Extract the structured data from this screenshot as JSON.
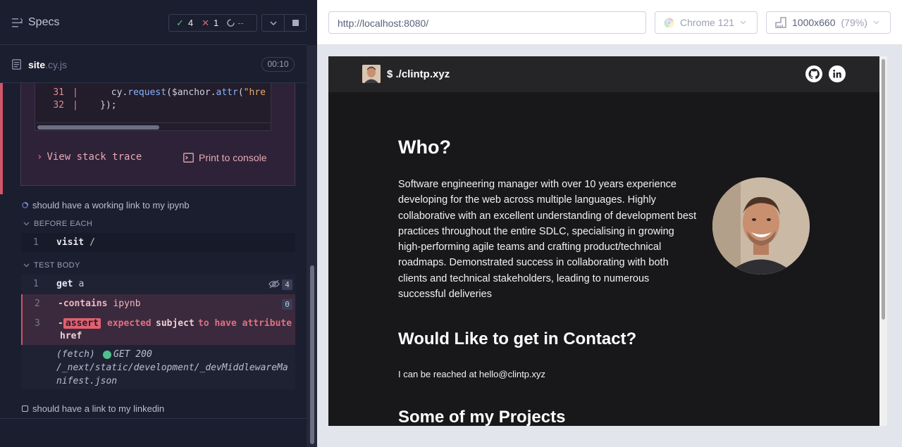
{
  "reporter": {
    "title": "Specs",
    "stats": {
      "passed": "4",
      "failed": "1",
      "pending": "--"
    },
    "file": {
      "name": "site",
      "ext": ".cy.js",
      "duration": "00:10"
    },
    "code_lines": [
      {
        "num": "31",
        "code": "      cy.request($anchor.attr(\"hre"
      },
      {
        "num": "32",
        "code": "    });"
      }
    ],
    "view_stack_trace": "View stack trace",
    "print_to_console": "Print to console",
    "tests": [
      {
        "title": "should have a working link to my ipynb"
      },
      {
        "title": "should have a link to my linkedin"
      }
    ],
    "before_each": {
      "label": "BEFORE EACH",
      "commands": [
        {
          "num": "1",
          "name": "visit",
          "arg": "/"
        }
      ]
    },
    "test_body": {
      "label": "TEST BODY",
      "commands": [
        {
          "num": "1",
          "name": "get",
          "arg": "a",
          "count": "4"
        },
        {
          "num": "2",
          "name": "-contains",
          "arg": "ipynb",
          "count": "0"
        },
        {
          "num": "3",
          "name": "-assert",
          "expected": "expected",
          "subject": "subject",
          "message": "to have attribute",
          "attr": "href"
        }
      ],
      "fetch": {
        "label": "(fetch)",
        "method": "GET 200",
        "url": "/_next/static/development/_devMiddlewareManifest.json"
      }
    }
  },
  "browser": {
    "url": "http://localhost:8080/",
    "name": "Chrome 121",
    "viewport": "1000x660",
    "zoom": "(79%)"
  },
  "site": {
    "logo": "$ ./clintp.xyz",
    "who_heading": "Who?",
    "bio": "Software engineering manager with over 10 years experience developing for the web across multiple languages. Highly collaborative with an excellent understanding of development best practices throughout the entire SDLC, specialising in growing high-performing agile teams and crafting product/technical roadmaps. Demonstrated success in collaborating with both clients and technical stakeholders, leading to numerous successful deliveries",
    "contact_heading": "Would Like to get in Contact?",
    "contact_text": "I can be reached at hello@clintp.xyz",
    "projects_heading": "Some of my Projects"
  },
  "colors": {
    "accent_fail": "#d0566a",
    "pass": "#4fc08d",
    "reporter_bg": "#1b1e2e",
    "site_bg": "#18181b"
  }
}
